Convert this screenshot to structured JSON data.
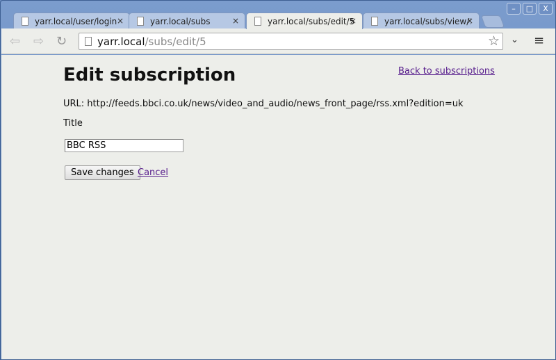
{
  "window": {
    "controls": [
      "–",
      "□",
      "X"
    ]
  },
  "tabs": [
    {
      "label": "yarr.local/user/login",
      "active": false
    },
    {
      "label": "yarr.local/subs",
      "active": false
    },
    {
      "label": "yarr.local/subs/edit/5",
      "active": true
    },
    {
      "label": "yarr.local/subs/view/5",
      "active": false
    }
  ],
  "omnibox": {
    "host": "yarr.local",
    "path": "/subs/edit/5"
  },
  "page": {
    "title": "Edit subscription",
    "back_link": "Back to subscriptions",
    "url_line": "URL: http://feeds.bbci.co.uk/news/video_and_audio/news_front_page/rss.xml?edition=uk",
    "title_label": "Title",
    "title_value": "BBC RSS",
    "save_label": "Save changes",
    "cancel_label": "Cancel"
  }
}
